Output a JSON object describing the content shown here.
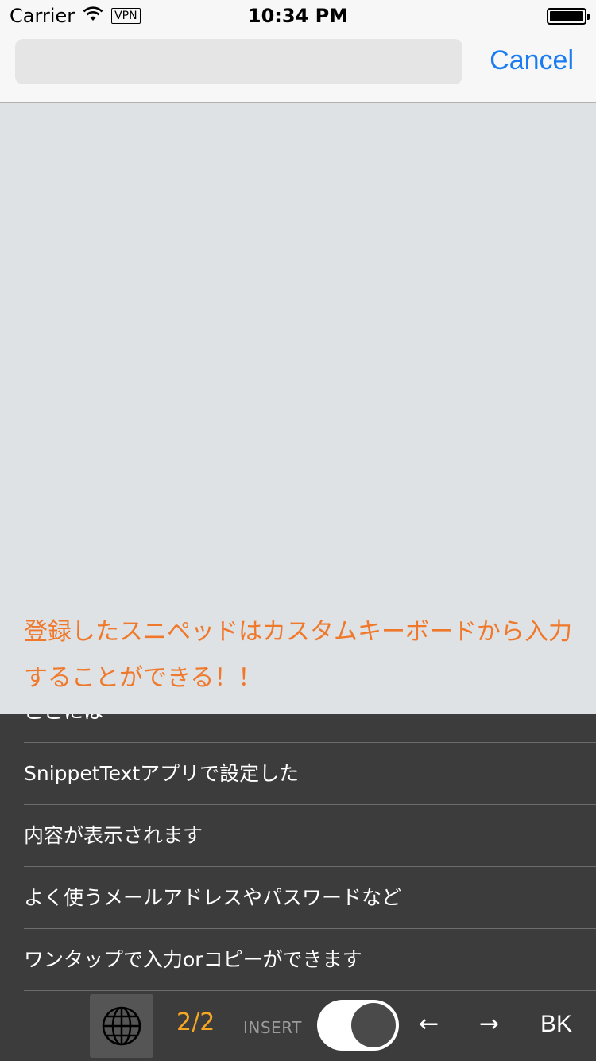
{
  "status_bar": {
    "carrier": "Carrier",
    "vpn": "VPN",
    "time": "10:34 PM",
    "battery_level": 1.0
  },
  "nav": {
    "search_value": "",
    "cancel_label": "Cancel"
  },
  "content": {
    "message": "登録したスニペッドはカスタムキーボードから入力することができる！！"
  },
  "keyboard": {
    "snippets": [
      "ここには",
      "SnippetTextアプリで設定した",
      "内容が表示されます",
      "よく使うメールアドレスやパスワードなど",
      "ワンタップで入力orコピーができます"
    ],
    "page_indicator": "2/2",
    "insert_label": "INSERT",
    "insert_toggle_on": true,
    "left_arrow": "←",
    "right_arrow": "→",
    "backspace_label": "BK"
  },
  "colors": {
    "accent_blue": "#1a7cf2",
    "message_orange": "#f0782a",
    "page_indicator_orange": "#f5a623",
    "keyboard_bg": "#3c3c3c"
  }
}
